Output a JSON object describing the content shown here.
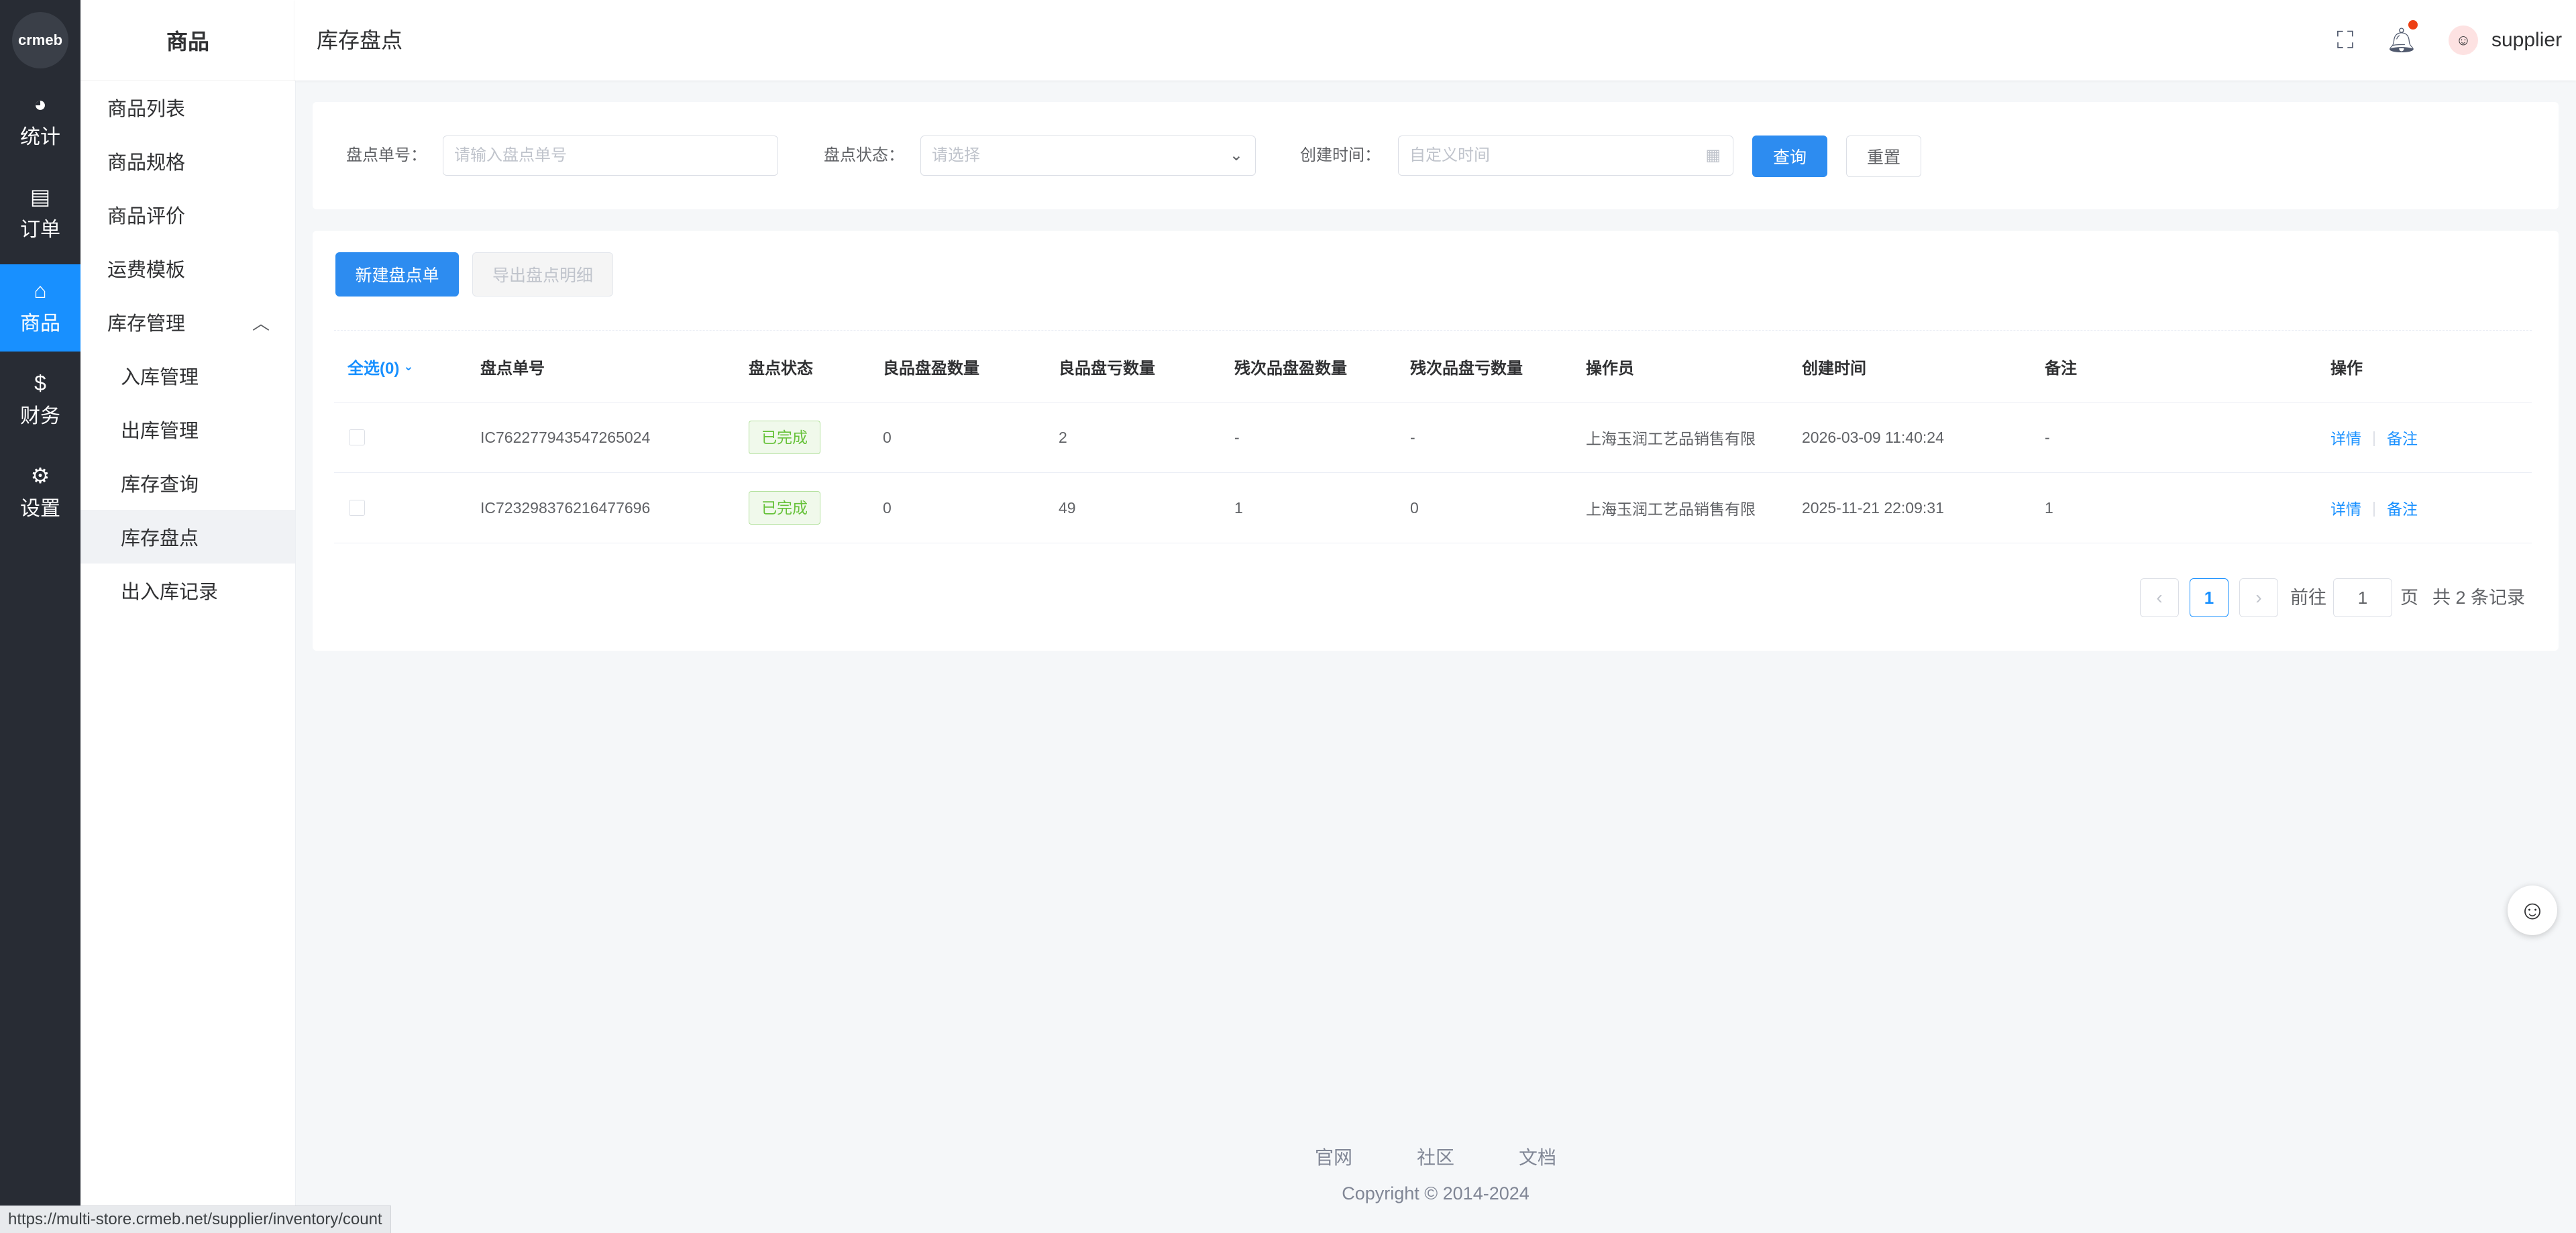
{
  "rail": {
    "logo": "crmeb",
    "items": [
      {
        "label": "统计",
        "icon": "pie-chart-icon"
      },
      {
        "label": "订单",
        "icon": "document-icon"
      },
      {
        "label": "商品",
        "icon": "basket-icon"
      },
      {
        "label": "财务",
        "icon": "dollar-icon"
      },
      {
        "label": "设置",
        "icon": "gear-icon"
      }
    ]
  },
  "submenu": {
    "title": "商品",
    "items": [
      {
        "label": "商品列表"
      },
      {
        "label": "商品规格"
      },
      {
        "label": "商品评价"
      },
      {
        "label": "运费模板"
      },
      {
        "label": "库存管理"
      },
      {
        "label": "入库管理"
      },
      {
        "label": "出库管理"
      },
      {
        "label": "库存查询"
      },
      {
        "label": "库存盘点"
      },
      {
        "label": "出入库记录"
      }
    ]
  },
  "header": {
    "title": "库存盘点",
    "username": "supplier",
    "icons": [
      "fullscreen-icon",
      "bell-icon"
    ]
  },
  "search": {
    "order_no_label": "盘点单号：",
    "order_no_placeholder": "请输入盘点单号",
    "status_label": "盘点状态：",
    "status_placeholder": "请选择",
    "time_label": "创建时间：",
    "time_placeholder": "自定义时间",
    "query_label": "查询",
    "reset_label": "重置"
  },
  "toolbar": {
    "new_label": "新建盘点单",
    "export_label": "导出盘点明细"
  },
  "table": {
    "select_all": "全选(0)",
    "columns": [
      "盘点单号",
      "盘点状态",
      "良品盘盈数量",
      "良品盘亏数量",
      "残次品盘盈数量",
      "残次品盘亏数量",
      "操作员",
      "创建时间",
      "备注",
      "操作"
    ],
    "rows": [
      {
        "order_no": "IC762277943547265024",
        "status": "已完成",
        "good_gain": "0",
        "good_loss": "2",
        "defect_gain": "-",
        "defect_loss": "-",
        "operator": "上海玉润工艺品销售有限",
        "created": "2026-03-09 11:40:24",
        "remark": "-",
        "action_detail": "详情",
        "action_remark": "备注"
      },
      {
        "order_no": "IC723298376216477696",
        "status": "已完成",
        "good_gain": "0",
        "good_loss": "49",
        "defect_gain": "1",
        "defect_loss": "0",
        "operator": "上海玉润工艺品销售有限",
        "created": "2025-11-21 22:09:31",
        "remark": "1",
        "action_detail": "详情",
        "action_remark": "备注"
      }
    ]
  },
  "pagination": {
    "current": "1",
    "goto_label": "前往",
    "goto_value": "1",
    "page_label": "页",
    "total": "共 2 条记录"
  },
  "footer": {
    "links": [
      "官网",
      "社区",
      "文档"
    ],
    "copyright": "Copyright © 2014-2024"
  },
  "statusbar": "https://multi-store.crmeb.net/supplier/inventory/count",
  "colors": {
    "primary": "#1890ff",
    "rail_bg": "#282c34",
    "success": "#67c23a"
  }
}
